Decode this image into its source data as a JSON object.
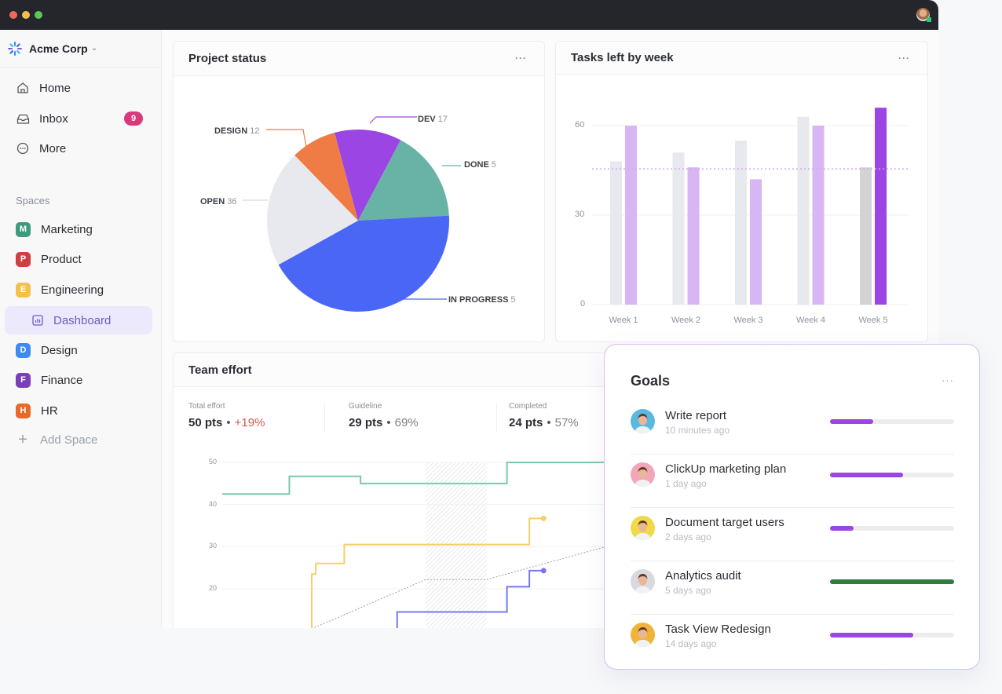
{
  "window": {
    "traffic_lights": [
      "#ee6a5f",
      "#f5bd4f",
      "#61c454"
    ],
    "user_avatar": "user-avatar"
  },
  "sidebar": {
    "workspace": {
      "name": "Acme Corp",
      "icon": "spinner-logo-icon",
      "caret": "⌄"
    },
    "nav": [
      {
        "label": "Home",
        "icon": "home-icon"
      },
      {
        "label": "Inbox",
        "icon": "inbox-icon",
        "badge": "9"
      },
      {
        "label": "More",
        "icon": "more-circle-icon"
      }
    ],
    "spaces_label": "Spaces",
    "spaces": [
      {
        "letter": "M",
        "label": "Marketing",
        "color": "#3f9a7d"
      },
      {
        "letter": "P",
        "label": "Product",
        "color": "#cf3f3f"
      },
      {
        "letter": "E",
        "label": "Engineering",
        "color": "#f5c04e"
      },
      {
        "letter": "D",
        "label": "Design",
        "color": "#3d8bf2"
      },
      {
        "letter": "F",
        "label": "Finance",
        "color": "#7b3fb8"
      },
      {
        "letter": "H",
        "label": "HR",
        "color": "#e8692a"
      }
    ],
    "active_child": {
      "label": "Dashboard",
      "icon": "dashboard-chart-icon"
    },
    "add_space": "Add Space"
  },
  "cards": {
    "project_status": {
      "title": "Project status",
      "menu": "···"
    },
    "tasks_left": {
      "title": "Tasks left by week",
      "menu": "···"
    },
    "team_effort": {
      "title": "Team effort",
      "stats": [
        {
          "label": "Total effort",
          "value": "50 pts",
          "sep": "•",
          "pct": "+19%",
          "trend": "up"
        },
        {
          "label": "Guideline",
          "value": "29 pts",
          "sep": "•",
          "pct": "69%"
        },
        {
          "label": "Completed",
          "value": "24 pts",
          "sep": "•",
          "pct": "57%"
        }
      ]
    }
  },
  "goals": {
    "title": "Goals",
    "menu": "···",
    "items": [
      {
        "name": "Write report",
        "time": "10 minutes ago",
        "progress": 0.35,
        "color": "#9b45e4",
        "avatar_bg": "#5bb8e0"
      },
      {
        "name": "ClickUp marketing plan",
        "time": "1 day ago",
        "progress": 0.59,
        "color": "#9b45e4",
        "avatar_bg": "#f2a6b8"
      },
      {
        "name": "Document target users",
        "time": "2 days ago",
        "progress": 0.19,
        "color": "#9b45e4",
        "avatar_bg": "#f2d94a"
      },
      {
        "name": "Analytics audit",
        "time": "5 days ago",
        "progress": 1.0,
        "color": "#2f7d3f",
        "avatar_bg": "#d8dae0"
      },
      {
        "name": "Task View Redesign",
        "time": "14 days ago",
        "progress": 0.67,
        "color": "#9b45e4",
        "avatar_bg": "#f2b33a"
      }
    ]
  },
  "chart_data": [
    {
      "type": "pie",
      "title": "Project status",
      "slices": [
        {
          "label": "DEV",
          "value": 17,
          "color": "#9b45e4",
          "share": 0.119
        },
        {
          "label": "DONE",
          "value": 5,
          "color": "#68b3a6",
          "share": 0.164
        },
        {
          "label": "IN PROGRESS",
          "value": 5,
          "color": "#4a66f5",
          "share": 0.428
        },
        {
          "label": "OPEN",
          "value": 36,
          "color": "#e8e9ee",
          "share": 0.208
        },
        {
          "label": "DESIGN",
          "value": 12,
          "color": "#ef7b45",
          "share": 0.081
        }
      ],
      "start_angle_deg": -15
    },
    {
      "type": "bar",
      "title": "Tasks left by week",
      "categories": [
        "Week 1",
        "Week 2",
        "Week 3",
        "Week 4",
        "Week 5"
      ],
      "series": [
        {
          "name": "baseline",
          "values": [
            48,
            51,
            55,
            63,
            46
          ],
          "colors": [
            "#e8e9ee",
            "#e8e9ee",
            "#e8e9ee",
            "#e8e9ee",
            "#d3d3d5"
          ]
        },
        {
          "name": "tasks",
          "values": [
            60,
            46,
            42,
            60,
            66
          ],
          "colors": [
            "#d8b6f3",
            "#d8b6f3",
            "#d8b6f3",
            "#d8b6f3",
            "#9b45e4"
          ]
        }
      ],
      "reference_line": {
        "value": 45.5,
        "color": "#d7a6f0",
        "style": "dotted"
      },
      "yticks": [
        0,
        30,
        60
      ],
      "ylim": [
        0,
        70
      ],
      "grid": true
    },
    {
      "type": "line",
      "title": "Team effort",
      "yticks": [
        20,
        30,
        40,
        50
      ],
      "ylim": [
        10,
        50
      ],
      "xlim": [
        0,
        100
      ],
      "shaded_range": [
        50,
        65
      ],
      "series": [
        {
          "name": "total",
          "color": "#7ccaa6",
          "step": true,
          "points": [
            [
              0,
              42.5
            ],
            [
              16.5,
              42.5
            ],
            [
              16.5,
              46.7
            ],
            [
              34,
              46.7
            ],
            [
              34,
              45
            ],
            [
              70,
              45
            ],
            [
              70,
              50
            ],
            [
              100,
              50
            ]
          ]
        },
        {
          "name": "completed",
          "color": "#f7cf6a",
          "step": true,
          "end_marker": true,
          "points": [
            [
              13,
              10.5
            ],
            [
              22,
              10.5
            ],
            [
              22,
              23.5
            ],
            [
              23,
              23.5
            ],
            [
              23,
              26
            ],
            [
              30,
              26
            ],
            [
              30,
              30.5
            ],
            [
              75.5,
              30.5
            ],
            [
              75.5,
              36.7
            ],
            [
              79,
              36.7
            ]
          ]
        },
        {
          "name": "in-progress",
          "color": "#7478ef",
          "step": true,
          "end_marker": true,
          "points": [
            [
              43,
              10
            ],
            [
              43,
              14.5
            ],
            [
              70,
              14.5
            ],
            [
              70,
              20.5
            ],
            [
              75.5,
              20.5
            ],
            [
              75.5,
              24.3
            ],
            [
              79,
              24.3
            ]
          ]
        },
        {
          "name": "guideline",
          "color": "#9aa0a8",
          "dashed": true,
          "points": [
            [
              22,
              10.5
            ],
            [
              50,
              22.2
            ],
            [
              65,
              22.2
            ],
            [
              100,
              31.5
            ]
          ]
        }
      ]
    }
  ]
}
